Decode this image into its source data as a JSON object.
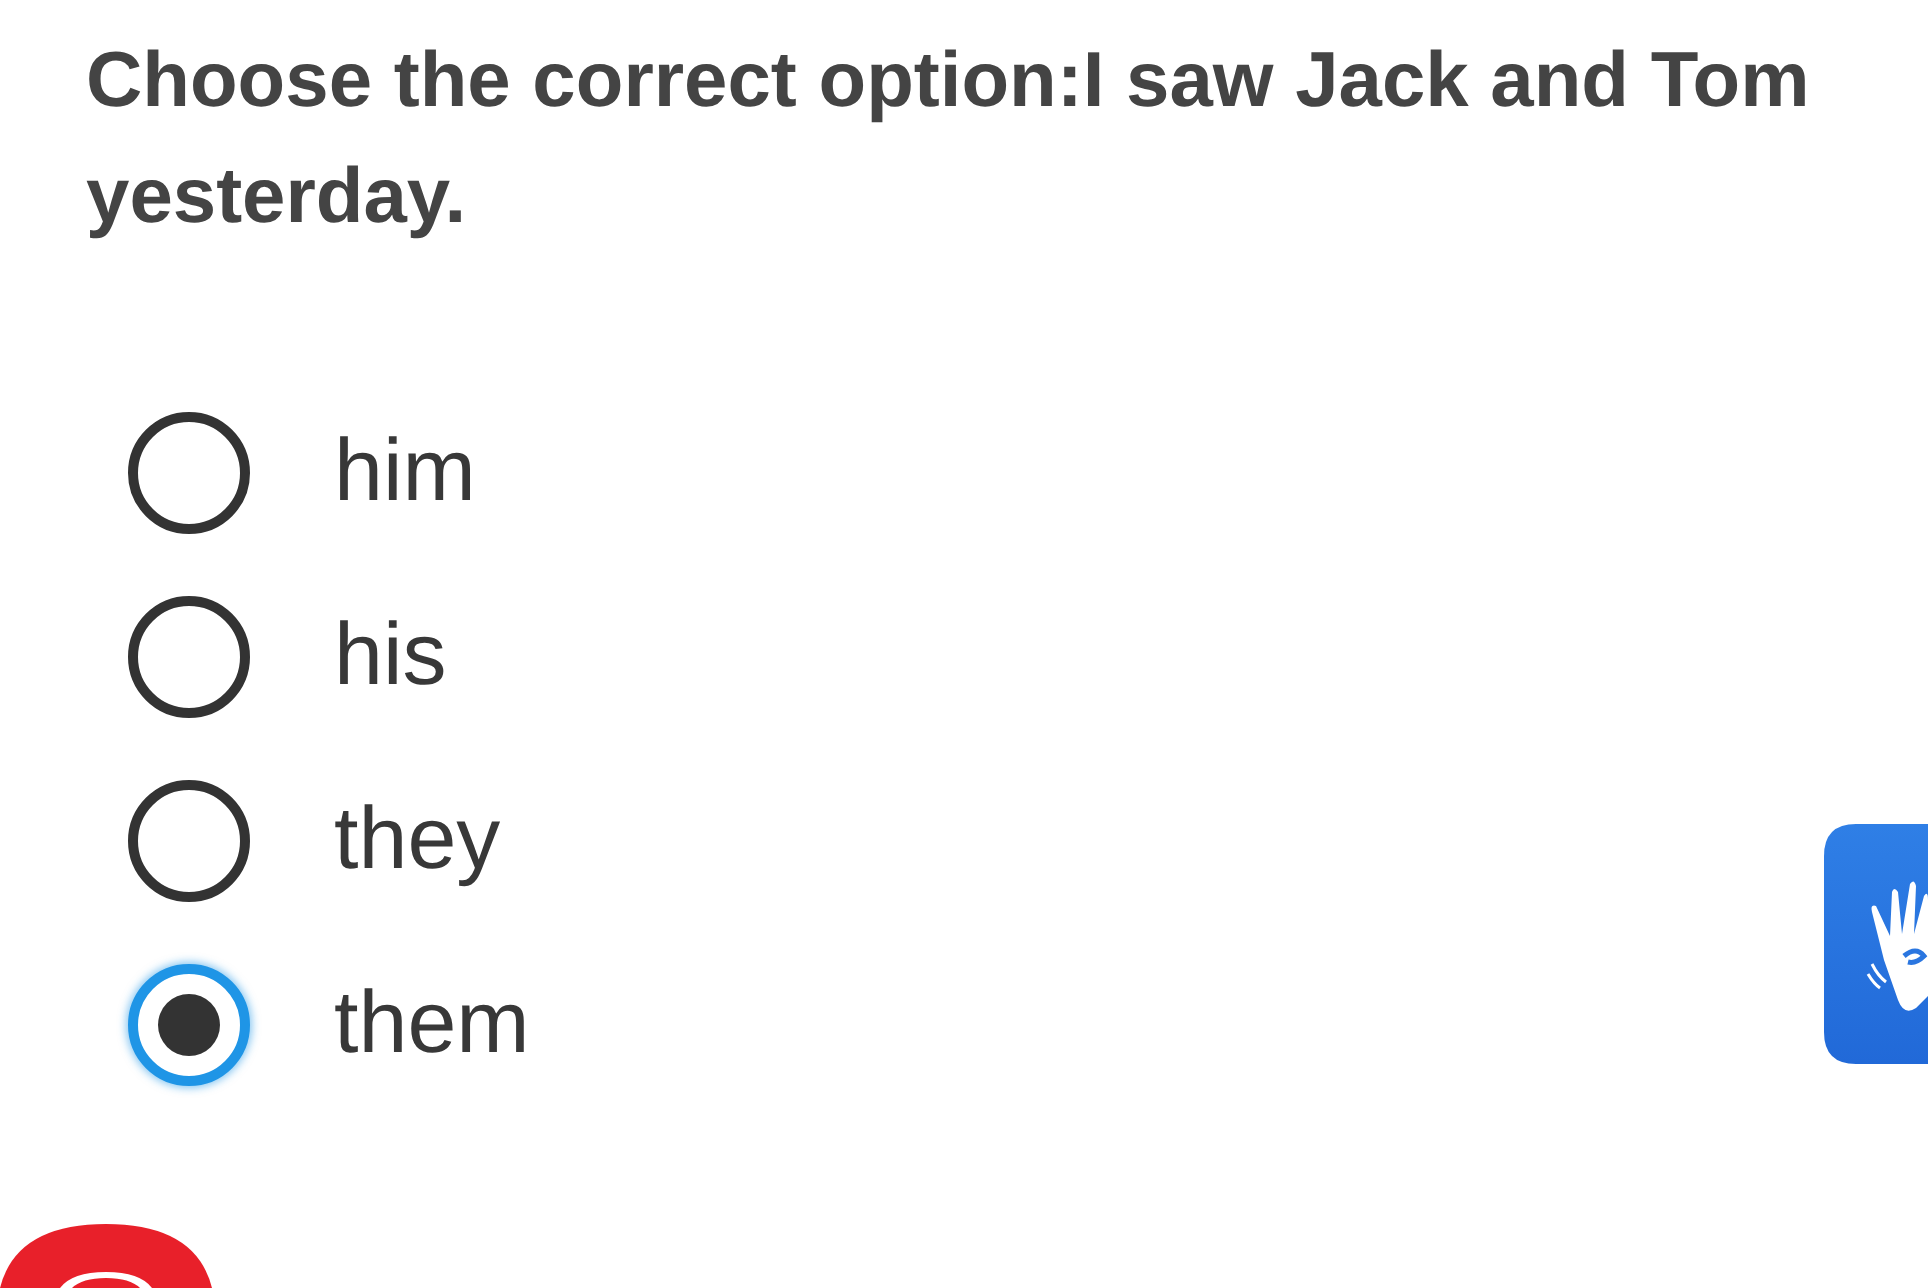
{
  "question": "Choose the correct option:I saw Jack and Tom yesterday.",
  "options": [
    {
      "label": "him",
      "selected": false
    },
    {
      "label": "his",
      "selected": false
    },
    {
      "label": "they",
      "selected": false
    },
    {
      "label": "them",
      "selected": true
    }
  ]
}
